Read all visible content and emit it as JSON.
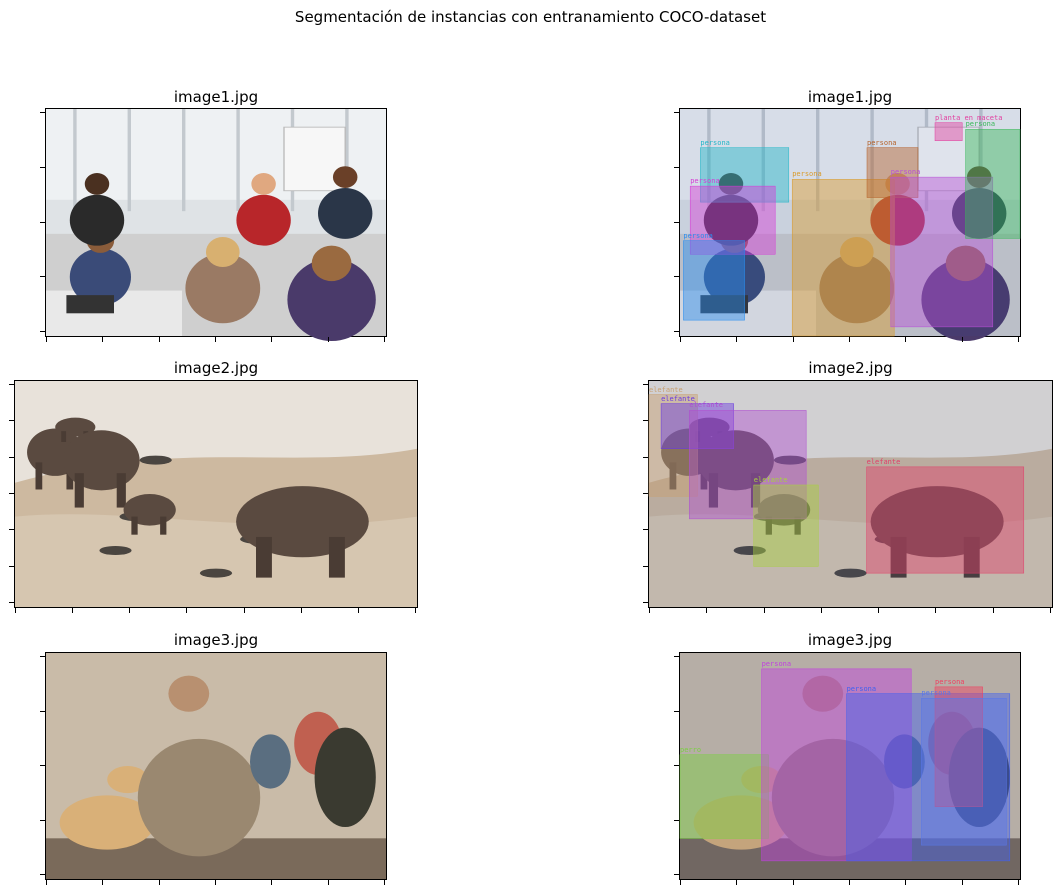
{
  "figure": {
    "suptitle": "Segmentación de instancias con entranamiento COCO-dataset"
  },
  "panels": [
    {
      "title": "image1.jpg",
      "scene": "office",
      "annotated": false
    },
    {
      "title": "image1.jpg",
      "scene": "office",
      "annotated": true,
      "detections": [
        {
          "label": "persona",
          "color": "#22b6c8"
        },
        {
          "label": "persona",
          "color": "#d63ad6"
        },
        {
          "label": "persona",
          "color": "#2a8ef0"
        },
        {
          "label": "persona",
          "color": "#d99a2a"
        },
        {
          "label": "persona",
          "color": "#b5622a"
        },
        {
          "label": "persona",
          "color": "#b84fd6"
        },
        {
          "label": "persona",
          "color": "#3ab85a"
        },
        {
          "label": "planta en maceta",
          "color": "#e23fa0"
        }
      ]
    },
    {
      "title": "image2.jpg",
      "scene": "elephants",
      "annotated": false
    },
    {
      "title": "image2.jpg",
      "scene": "elephants",
      "annotated": true,
      "detections": [
        {
          "label": "elefante",
          "color": "#c8a070"
        },
        {
          "label": "elefante",
          "color": "#6a3ae0"
        },
        {
          "label": "elefante",
          "color": "#b04fd0"
        },
        {
          "label": "elefante",
          "color": "#a8d040"
        },
        {
          "label": "elefante",
          "color": "#e0406a"
        }
      ]
    },
    {
      "title": "image3.jpg",
      "scene": "soldier",
      "annotated": false
    },
    {
      "title": "image3.jpg",
      "scene": "soldier",
      "annotated": true,
      "detections": [
        {
          "label": "perro",
          "color": "#7ad040"
        },
        {
          "label": "persona",
          "color": "#c040e0"
        },
        {
          "label": "persona",
          "color": "#4060f0"
        },
        {
          "label": "persona",
          "color": "#f04060"
        },
        {
          "label": "persona",
          "color": "#5a78e8"
        }
      ]
    }
  ]
}
